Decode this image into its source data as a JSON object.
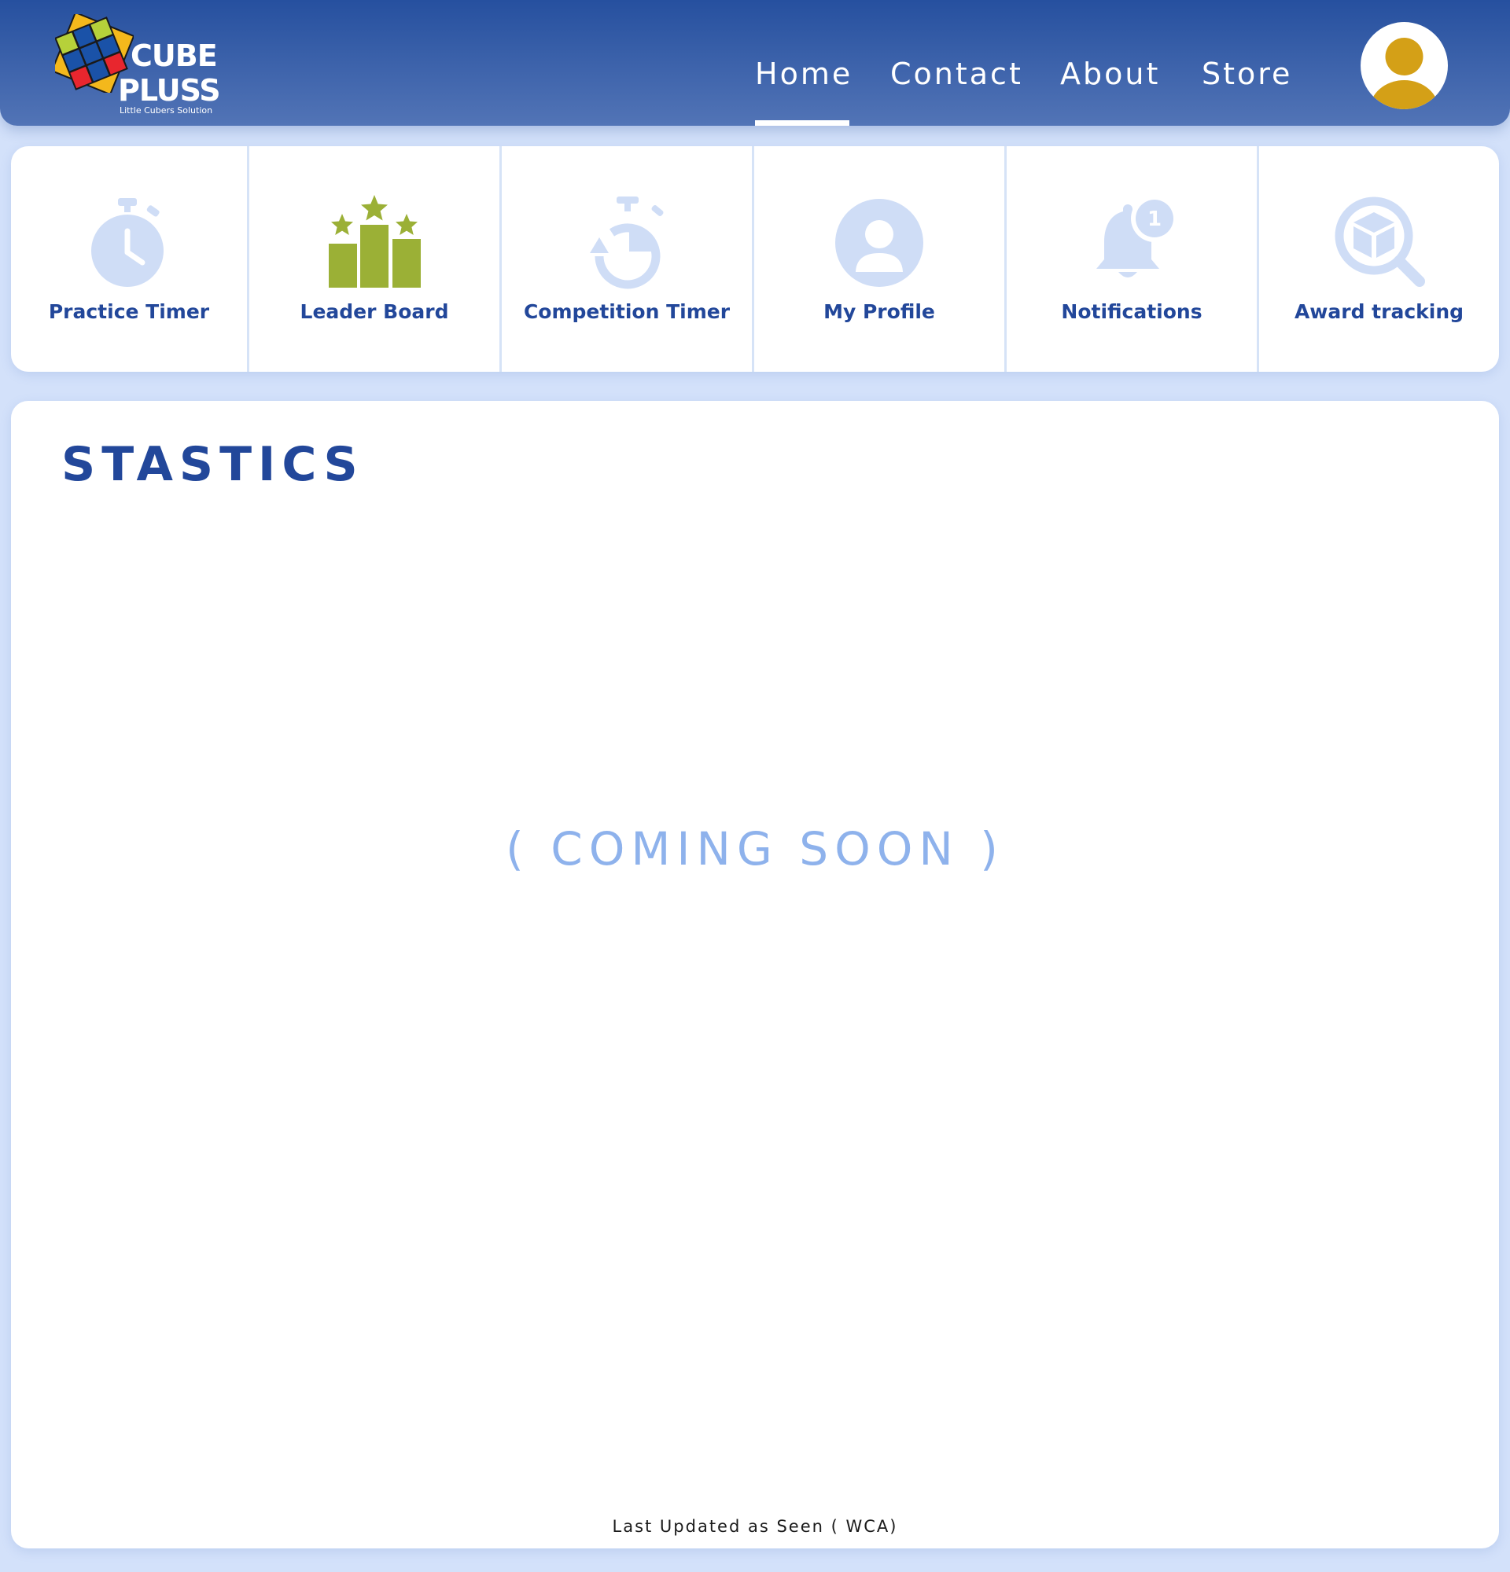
{
  "header": {
    "logo": {
      "word_1": "CUBE",
      "word_2": "PLUSS",
      "tagline": "Little Cubers Solution"
    },
    "nav": [
      {
        "label": "Home",
        "active": true
      },
      {
        "label": "Contact",
        "active": false
      },
      {
        "label": "About",
        "active": false
      },
      {
        "label": "Store",
        "active": false
      }
    ],
    "avatar_icon": "user-avatar-icon"
  },
  "tiles": [
    {
      "label": "Practice Timer",
      "icon": "stopwatch-icon"
    },
    {
      "label": "Leader Board",
      "icon": "podium-stars-icon"
    },
    {
      "label": "Competition Timer",
      "icon": "competition-timer-icon"
    },
    {
      "label": "My Profile",
      "icon": "profile-icon"
    },
    {
      "label": "Notifications",
      "icon": "bell-icon",
      "badge": "1"
    },
    {
      "label": "Award tracking",
      "icon": "award-search-icon"
    }
  ],
  "statistics": {
    "title": "STASTICS",
    "placeholder": "( COMING SOON )",
    "footer_note": "Last Updated as Seen ( WCA)"
  },
  "colors": {
    "header_top": "#26509f",
    "header_bottom": "#5274b6",
    "page_bg": "#d3e1fa",
    "accent_text": "#22479a",
    "icon_light": "#cfddf6",
    "leaderboard_green": "#9bb036",
    "avatar_gold": "#d4a017",
    "coming_soon": "#8eb2ec"
  }
}
